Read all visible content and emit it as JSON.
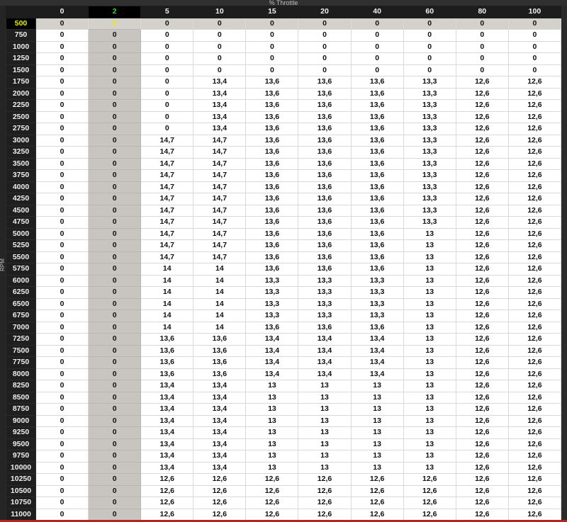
{
  "x_axis_label": "% Throttle",
  "y_axis_label": "RPM",
  "columns": [
    "0",
    "2",
    "5",
    "10",
    "15",
    "20",
    "40",
    "60",
    "80",
    "100"
  ],
  "selected_column_index": 1,
  "selected_row_index": 0,
  "rows": [
    {
      "rpm": "500",
      "values": [
        "0",
        "0",
        "0",
        "0",
        "0",
        "0",
        "0",
        "0",
        "0",
        "0"
      ]
    },
    {
      "rpm": "750",
      "values": [
        "0",
        "0",
        "0",
        "0",
        "0",
        "0",
        "0",
        "0",
        "0",
        "0"
      ]
    },
    {
      "rpm": "1000",
      "values": [
        "0",
        "0",
        "0",
        "0",
        "0",
        "0",
        "0",
        "0",
        "0",
        "0"
      ]
    },
    {
      "rpm": "1250",
      "values": [
        "0",
        "0",
        "0",
        "0",
        "0",
        "0",
        "0",
        "0",
        "0",
        "0"
      ]
    },
    {
      "rpm": "1500",
      "values": [
        "0",
        "0",
        "0",
        "0",
        "0",
        "0",
        "0",
        "0",
        "0",
        "0"
      ]
    },
    {
      "rpm": "1750",
      "values": [
        "0",
        "0",
        "0",
        "13,4",
        "13,6",
        "13,6",
        "13,6",
        "13,3",
        "12,6",
        "12,6"
      ]
    },
    {
      "rpm": "2000",
      "values": [
        "0",
        "0",
        "0",
        "13,4",
        "13,6",
        "13,6",
        "13,6",
        "13,3",
        "12,6",
        "12,6"
      ]
    },
    {
      "rpm": "2250",
      "values": [
        "0",
        "0",
        "0",
        "13,4",
        "13,6",
        "13,6",
        "13,6",
        "13,3",
        "12,6",
        "12,6"
      ]
    },
    {
      "rpm": "2500",
      "values": [
        "0",
        "0",
        "0",
        "13,4",
        "13,6",
        "13,6",
        "13,6",
        "13,3",
        "12,6",
        "12,6"
      ]
    },
    {
      "rpm": "2750",
      "values": [
        "0",
        "0",
        "0",
        "13,4",
        "13,6",
        "13,6",
        "13,6",
        "13,3",
        "12,6",
        "12,6"
      ]
    },
    {
      "rpm": "3000",
      "values": [
        "0",
        "0",
        "14,7",
        "14,7",
        "13,6",
        "13,6",
        "13,6",
        "13,3",
        "12,6",
        "12,6"
      ]
    },
    {
      "rpm": "3250",
      "values": [
        "0",
        "0",
        "14,7",
        "14,7",
        "13,6",
        "13,6",
        "13,6",
        "13,3",
        "12,6",
        "12,6"
      ]
    },
    {
      "rpm": "3500",
      "values": [
        "0",
        "0",
        "14,7",
        "14,7",
        "13,6",
        "13,6",
        "13,6",
        "13,3",
        "12,6",
        "12,6"
      ]
    },
    {
      "rpm": "3750",
      "values": [
        "0",
        "0",
        "14,7",
        "14,7",
        "13,6",
        "13,6",
        "13,6",
        "13,3",
        "12,6",
        "12,6"
      ]
    },
    {
      "rpm": "4000",
      "values": [
        "0",
        "0",
        "14,7",
        "14,7",
        "13,6",
        "13,6",
        "13,6",
        "13,3",
        "12,6",
        "12,6"
      ]
    },
    {
      "rpm": "4250",
      "values": [
        "0",
        "0",
        "14,7",
        "14,7",
        "13,6",
        "13,6",
        "13,6",
        "13,3",
        "12,6",
        "12,6"
      ]
    },
    {
      "rpm": "4500",
      "values": [
        "0",
        "0",
        "14,7",
        "14,7",
        "13,6",
        "13,6",
        "13,6",
        "13,3",
        "12,6",
        "12,6"
      ]
    },
    {
      "rpm": "4750",
      "values": [
        "0",
        "0",
        "14,7",
        "14,7",
        "13,6",
        "13,6",
        "13,6",
        "13,3",
        "12,6",
        "12,6"
      ]
    },
    {
      "rpm": "5000",
      "values": [
        "0",
        "0",
        "14,7",
        "14,7",
        "13,6",
        "13,6",
        "13,6",
        "13",
        "12,6",
        "12,6"
      ]
    },
    {
      "rpm": "5250",
      "values": [
        "0",
        "0",
        "14,7",
        "14,7",
        "13,6",
        "13,6",
        "13,6",
        "13",
        "12,6",
        "12,6"
      ]
    },
    {
      "rpm": "5500",
      "values": [
        "0",
        "0",
        "14,7",
        "14,7",
        "13,6",
        "13,6",
        "13,6",
        "13",
        "12,6",
        "12,6"
      ]
    },
    {
      "rpm": "5750",
      "values": [
        "0",
        "0",
        "14",
        "14",
        "13,6",
        "13,6",
        "13,6",
        "13",
        "12,6",
        "12,6"
      ]
    },
    {
      "rpm": "6000",
      "values": [
        "0",
        "0",
        "14",
        "14",
        "13,3",
        "13,3",
        "13,3",
        "13",
        "12,6",
        "12,6"
      ]
    },
    {
      "rpm": "6250",
      "values": [
        "0",
        "0",
        "14",
        "14",
        "13,3",
        "13,3",
        "13,3",
        "13",
        "12,6",
        "12,6"
      ]
    },
    {
      "rpm": "6500",
      "values": [
        "0",
        "0",
        "14",
        "14",
        "13,3",
        "13,3",
        "13,3",
        "13",
        "12,6",
        "12,6"
      ]
    },
    {
      "rpm": "6750",
      "values": [
        "0",
        "0",
        "14",
        "14",
        "13,3",
        "13,3",
        "13,3",
        "13",
        "12,6",
        "12,6"
      ]
    },
    {
      "rpm": "7000",
      "values": [
        "0",
        "0",
        "14",
        "14",
        "13,6",
        "13,6",
        "13,6",
        "13",
        "12,6",
        "12,6"
      ]
    },
    {
      "rpm": "7250",
      "values": [
        "0",
        "0",
        "13,6",
        "13,6",
        "13,4",
        "13,4",
        "13,4",
        "13",
        "12,6",
        "12,6"
      ]
    },
    {
      "rpm": "7500",
      "values": [
        "0",
        "0",
        "13,6",
        "13,6",
        "13,4",
        "13,4",
        "13,4",
        "13",
        "12,6",
        "12,6"
      ]
    },
    {
      "rpm": "7750",
      "values": [
        "0",
        "0",
        "13,6",
        "13,6",
        "13,4",
        "13,4",
        "13,4",
        "13",
        "12,6",
        "12,6"
      ]
    },
    {
      "rpm": "8000",
      "values": [
        "0",
        "0",
        "13,6",
        "13,6",
        "13,4",
        "13,4",
        "13,4",
        "13",
        "12,6",
        "12,6"
      ]
    },
    {
      "rpm": "8250",
      "values": [
        "0",
        "0",
        "13,4",
        "13,4",
        "13",
        "13",
        "13",
        "13",
        "12,6",
        "12,6"
      ]
    },
    {
      "rpm": "8500",
      "values": [
        "0",
        "0",
        "13,4",
        "13,4",
        "13",
        "13",
        "13",
        "13",
        "12,6",
        "12,6"
      ]
    },
    {
      "rpm": "8750",
      "values": [
        "0",
        "0",
        "13,4",
        "13,4",
        "13",
        "13",
        "13",
        "13",
        "12,6",
        "12,6"
      ]
    },
    {
      "rpm": "9000",
      "values": [
        "0",
        "0",
        "13,4",
        "13,4",
        "13",
        "13",
        "13",
        "13",
        "12,6",
        "12,6"
      ]
    },
    {
      "rpm": "9250",
      "values": [
        "0",
        "0",
        "13,4",
        "13,4",
        "13",
        "13",
        "13",
        "13",
        "12,6",
        "12,6"
      ]
    },
    {
      "rpm": "9500",
      "values": [
        "0",
        "0",
        "13,4",
        "13,4",
        "13",
        "13",
        "13",
        "13",
        "12,6",
        "12,6"
      ]
    },
    {
      "rpm": "9750",
      "values": [
        "0",
        "0",
        "13,4",
        "13,4",
        "13",
        "13",
        "13",
        "13",
        "12,6",
        "12,6"
      ]
    },
    {
      "rpm": "10000",
      "values": [
        "0",
        "0",
        "13,4",
        "13,4",
        "13",
        "13",
        "13",
        "13",
        "12,6",
        "12,6"
      ]
    },
    {
      "rpm": "10250",
      "values": [
        "0",
        "0",
        "12,6",
        "12,6",
        "12,6",
        "12,6",
        "12,6",
        "12,6",
        "12,6",
        "12,6"
      ]
    },
    {
      "rpm": "10500",
      "values": [
        "0",
        "0",
        "12,6",
        "12,6",
        "12,6",
        "12,6",
        "12,6",
        "12,6",
        "12,6",
        "12,6"
      ]
    },
    {
      "rpm": "10750",
      "values": [
        "0",
        "0",
        "12,6",
        "12,6",
        "12,6",
        "12,6",
        "12,6",
        "12,6",
        "12,6",
        "12,6"
      ]
    },
    {
      "rpm": "11000",
      "values": [
        "0",
        "0",
        "12,6",
        "12,6",
        "12,6",
        "12,6",
        "12,6",
        "12,6",
        "12,6",
        "12,6"
      ]
    }
  ]
}
